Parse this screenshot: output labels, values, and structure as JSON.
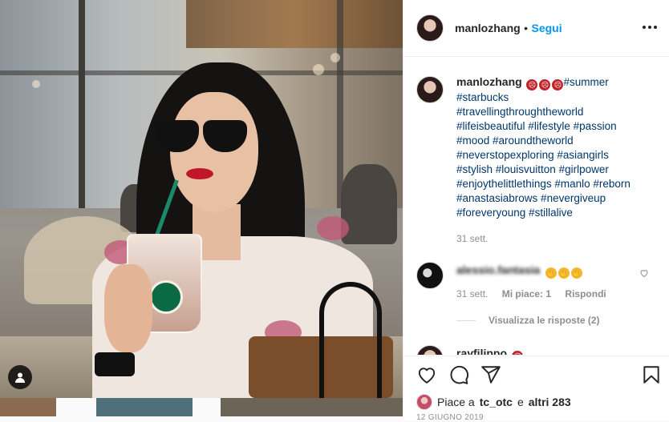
{
  "header": {
    "username": "manlozhang",
    "separator": "•",
    "follow_label": "Segui"
  },
  "caption": {
    "username": "manlozhang",
    "first_tag": "#summer",
    "tags": [
      "#starbucks",
      "#travellingthroughtheworld",
      "#lifeisbeautiful #lifestyle #passion",
      "#mood #aroundtheworld",
      "#neverstopexploring #asiangirls",
      "#stylish #louisvuitton #girlpower",
      "#enjoythelittlethings #manlo #reborn",
      "#anastasiabrows #nevergiveup",
      "#foreveryoung #stillalive"
    ],
    "time": "31 sett."
  },
  "comment1": {
    "username": "alessio.fantasia",
    "time": "31 sett.",
    "likes": "Mi piace: 1",
    "reply_label": "Rispondi",
    "view_replies": "Visualizza le risposte (2)"
  },
  "comment2": {
    "username": "rayfilippo"
  },
  "likes": {
    "prefix": "Piace a",
    "user": "tc_otc",
    "joiner": "e",
    "others": "altri 283"
  },
  "date": "12 giugno 2019",
  "colors": {
    "link": "#00376b",
    "follow": "#0095f6",
    "muted": "#8e8e8e"
  }
}
